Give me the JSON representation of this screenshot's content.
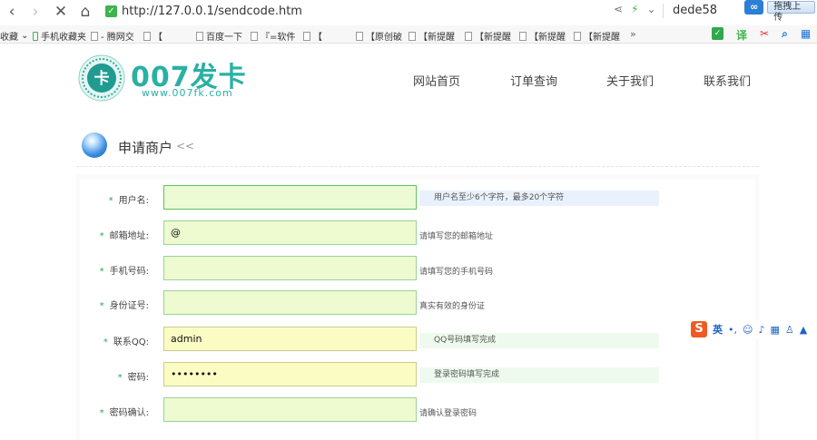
{
  "browser": {
    "url": "http://127.0.0.1/sendcode.htm",
    "user": "dede58",
    "upload_logo": "∞",
    "upload_label": "拖拽上传",
    "bookmarks": [
      "收藏",
      "手机收藏夹",
      "- 腾网交",
      "【",
      "百度一下",
      "『=软件",
      "【",
      "【原创破",
      "【新提醒",
      "【新提醒",
      "【新提醒",
      "【新提醒"
    ],
    "bookmarks_more": "»"
  },
  "site": {
    "logo_title": "007发卡",
    "logo_url": "www.007fk.com",
    "logo_glyph": "卡",
    "nav": [
      "网站首页",
      "订单查询",
      "关于我们",
      "联系我们"
    ]
  },
  "section": {
    "title": "申请商户",
    "back": "<<"
  },
  "form": {
    "required_mark": "*",
    "fields": [
      {
        "label": "用户名:",
        "value": "",
        "placeholder": "",
        "hint": "用户名至少6个字符，最多20个字符"
      },
      {
        "label": "邮箱地址:",
        "value": "@",
        "placeholder": "",
        "hint": "请填写您的邮箱地址"
      },
      {
        "label": "手机号码:",
        "value": "",
        "placeholder": "",
        "hint": "请填写您的手机号码"
      },
      {
        "label": "身份证号:",
        "value": "",
        "placeholder": "",
        "hint": "真实有效的身份证"
      },
      {
        "label": "联系QQ:",
        "value": "admin",
        "placeholder": "",
        "hint": "QQ号码填写完成"
      },
      {
        "label": "密码:",
        "value": "••••••••",
        "placeholder": "",
        "hint": "登录密码填写完成"
      },
      {
        "label": "密码确认:",
        "value": "",
        "placeholder": "",
        "hint": "请确认登录密码"
      }
    ]
  },
  "ime": {
    "logo": "S",
    "lang": "英"
  },
  "colors": {
    "brand": "#2ab0a4",
    "required": "#2aa844",
    "field_bg": "#eefacf",
    "field_border": "#9ad39a"
  }
}
